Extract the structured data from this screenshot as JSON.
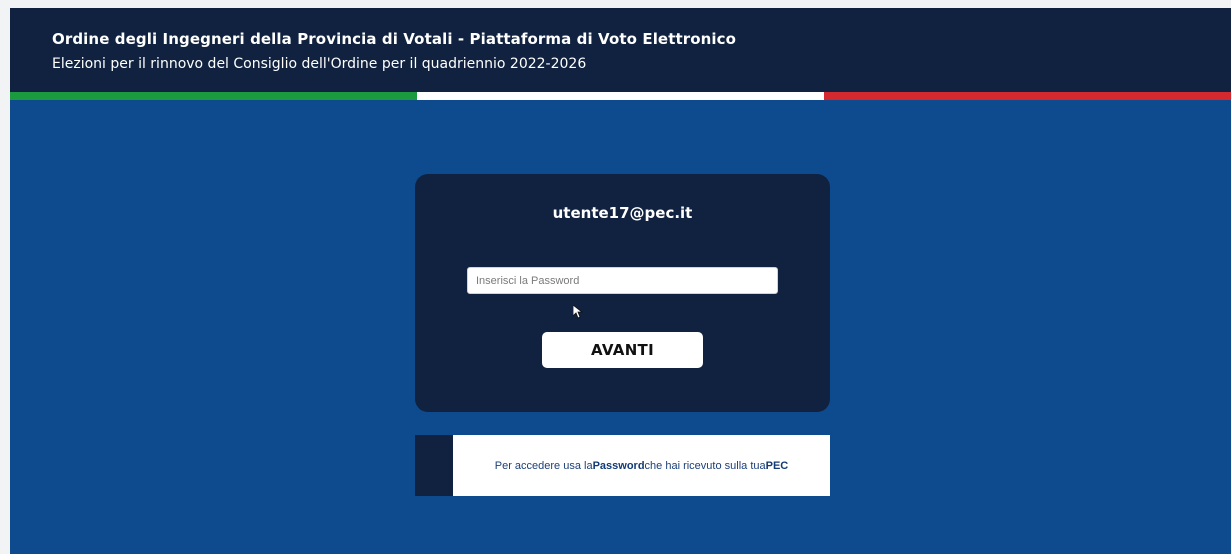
{
  "header": {
    "title": "Ordine degli Ingegneri della Provincia di Votali - Piattaforma di Voto Elettronico",
    "subtitle": "Elezioni per il rinnovo del Consiglio dell'Ordine per il quadriennio 2022-2026"
  },
  "flag": {
    "colors": [
      "#1b9a3f",
      "#ffffff",
      "#d42a2f"
    ]
  },
  "colors": {
    "header_background": "#10223f",
    "page_background": "#0e4a8e",
    "card_background": "#10223f",
    "button_background": "#ffffff"
  },
  "login": {
    "user": "utente17@pec.it",
    "password_placeholder": "Inserisci la Password",
    "password_value": "",
    "submit_label": "AVANTI"
  },
  "info": {
    "text_before": "Per accedere usa la ",
    "password_word": "Password",
    "text_middle": " che hai ricevuto sulla tua ",
    "pec_word": "PEC"
  },
  "icons": {
    "cursor": "mouse-pointer-icon"
  }
}
